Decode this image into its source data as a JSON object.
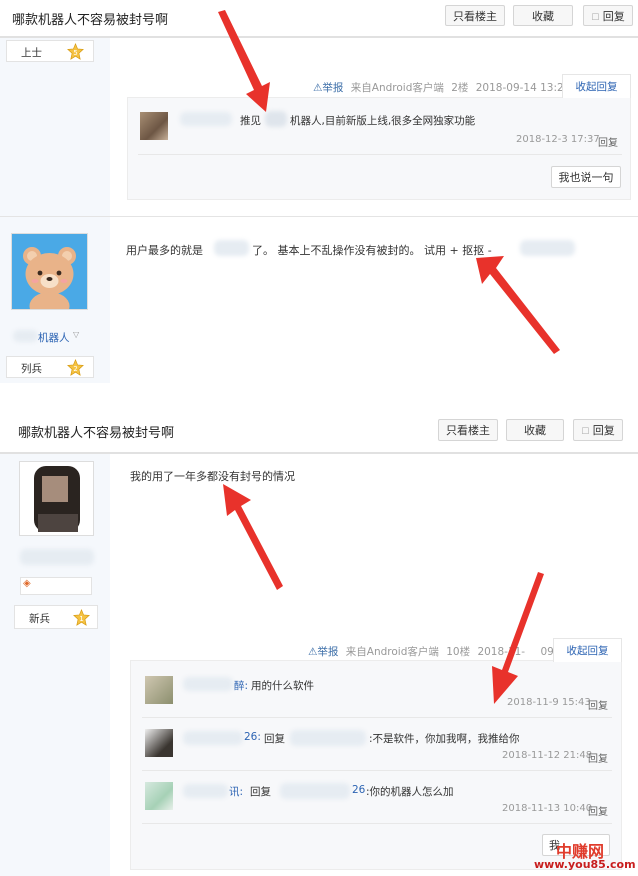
{
  "header": {
    "title": "哪款机器人不容易被封号啊",
    "only_op": "只看楼主",
    "favorite": "收藏",
    "reply": "回复"
  },
  "post1": {
    "rank": "上士",
    "level": "5",
    "meta": {
      "report": "举报",
      "source": "来自Android客户端",
      "floor": "2楼",
      "time": "2018-09-14 13:22"
    },
    "collapse": "收起回复",
    "comment": {
      "text_a": "推见",
      "text_b": "机器人,目前新版上线,很多全网独家功能",
      "time": "2018-12-3 17:37",
      "reply": "回复"
    },
    "say_button": "我也说一句"
  },
  "post2": {
    "username": "机器人",
    "rank": "列兵",
    "level": "2",
    "content_a": "用户最多的就是",
    "content_b": "了。 基本上不乱操作没有被封的。 试用 + 抠抠 -"
  },
  "post3": {
    "rank": "新兵",
    "level": "1",
    "content": "我的用了一年多都没有封号的情况",
    "meta": {
      "report": "举报",
      "source": "来自Android客户端",
      "floor": "10楼",
      "time_a": "2018-11-",
      "time_b": "09:51"
    },
    "collapse": "收起回复",
    "comments": [
      {
        "name_tail": "醉:",
        "text": "用的什么软件",
        "time": "2018-11-9 15:43",
        "reply": "回复"
      },
      {
        "name_tail": "26:",
        "mid": "回复",
        "text": ":不是软件，你加我啊，我推给你",
        "time": "2018-11-12 21:48",
        "reply": "回复"
      },
      {
        "name_tail": "讯:",
        "mid": "回复",
        "name2_tail": "26",
        "text": ":你的机器人怎么加",
        "time": "2018-11-13 10:40",
        "reply": "回复"
      }
    ],
    "say_button": "我"
  },
  "watermark": {
    "name": "中赚网",
    "url": "www.you85.com"
  },
  "colors": {
    "arrow": "#e8322b",
    "link": "#2d64b3",
    "badge_gold": "#f5c242"
  }
}
